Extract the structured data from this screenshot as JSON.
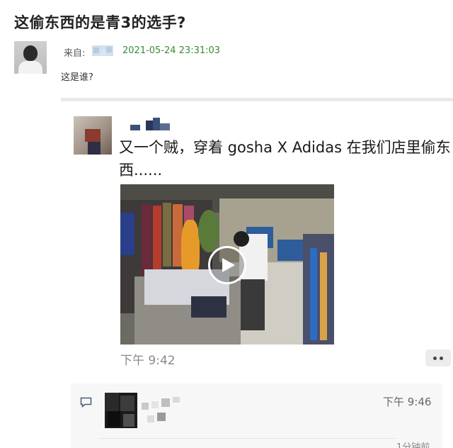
{
  "post": {
    "title": "这偷东西的是青3的选手?",
    "from_label": "来自:",
    "timestamp": "2021-05-24 23:31:03",
    "body": "这是谁?"
  },
  "chat": {
    "message": "又一个贼，穿着 gosha X Adidas 在我们店里偷东西......",
    "time": "下午 9:42",
    "comment": {
      "time": "下午 9:46",
      "partial_text": "1分钟前"
    }
  },
  "icons": {
    "play": "play-icon",
    "more": "more-dots-icon",
    "comment": "comment-bubble-icon"
  },
  "colors": {
    "timestamp_green": "#3a8a3a",
    "divider": "#e9e9e9"
  }
}
